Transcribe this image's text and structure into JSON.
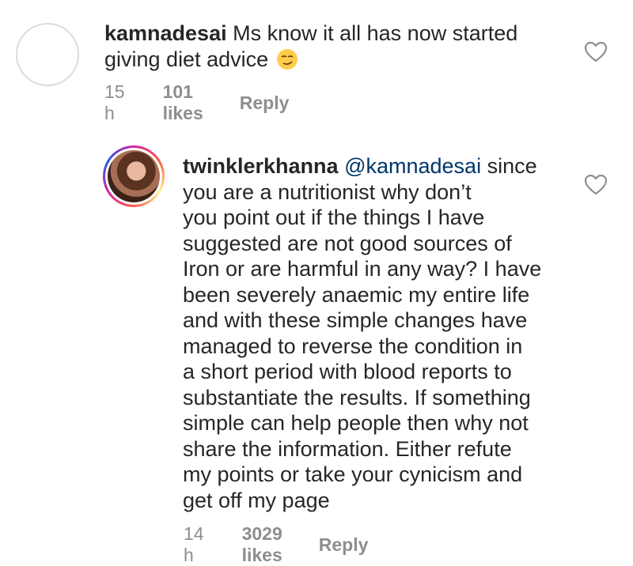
{
  "comments": [
    {
      "username": "kamnadesai",
      "text_line1": "Ms know it all has now started",
      "text_line2": "giving diet advice",
      "emoji": "smirking-face",
      "time": "15 h",
      "likes": "101 likes",
      "reply": "Reply"
    },
    {
      "username": "twinklerkhanna",
      "mention": "@kamnadesai",
      "lines": [
        "since",
        "you are a nutritionist why don’t",
        "you point out if the things I have",
        "suggested are not good sources of",
        "Iron or are harmful in any way? I have",
        "been severely anaemic my entire life",
        "and with these simple changes have",
        "managed to reverse the condition in",
        "a short period with blood reports to",
        "substantiate the results. If something",
        "simple can help people then why not",
        "share the information. Either refute",
        "my points or take your cynicism and",
        "get off my page"
      ],
      "time": "14 h",
      "likes": "3029 likes",
      "reply": "Reply"
    }
  ],
  "colors": {
    "text": "#262626",
    "meta": "#8e8e8e",
    "mention": "#003569"
  }
}
